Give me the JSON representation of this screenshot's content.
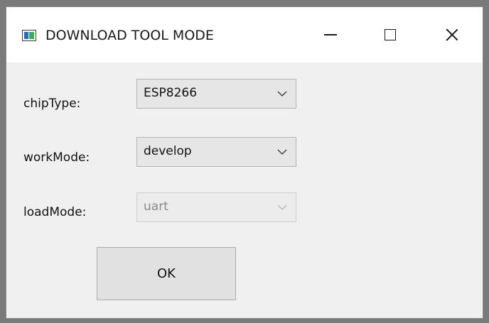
{
  "window": {
    "title": "DOWNLOAD TOOL MODE",
    "icon": "app-window-icon"
  },
  "controls": {
    "minimize_icon": "minimize-icon",
    "maximize_icon": "maximize-icon",
    "close_icon": "close-icon"
  },
  "form": {
    "chip_type": {
      "label": "chipType:",
      "value": "ESP8266",
      "enabled": true
    },
    "work_mode": {
      "label": "workMode:",
      "value": "develop",
      "enabled": true
    },
    "load_mode": {
      "label": "loadMode:",
      "value": "uart",
      "enabled": false
    }
  },
  "buttons": {
    "ok_label": "OK"
  },
  "colors": {
    "background": "#f0f0f0",
    "titlebar": "#ffffff",
    "disabled_text": "#8a8a8a"
  }
}
